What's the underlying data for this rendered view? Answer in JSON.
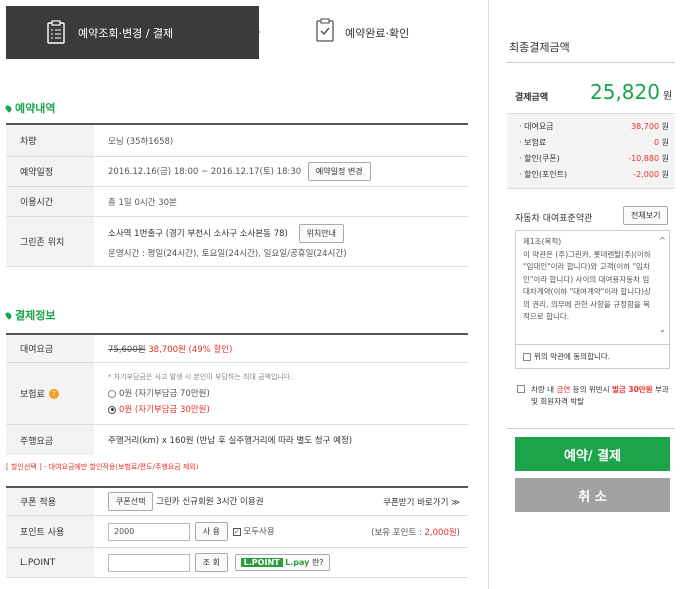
{
  "steps": {
    "step1": "예약조회·변경 / 결제",
    "step2": "예약완료·확인"
  },
  "reservation": {
    "title": "예약내역",
    "rows": {
      "car": {
        "label": "차량",
        "value": "모닝 (35하1658)"
      },
      "schedule": {
        "label": "예약일정",
        "value": "2016.12.16(금) 18:00 ~ 2016.12.17(토) 18:30",
        "button": "예약일정 변경"
      },
      "usage": {
        "label": "이용시간",
        "value": "총 1일 0시간 30분"
      },
      "greenzone": {
        "label": "그린존 위치",
        "address": "소사역 1번출구 (경기 부천시 소사구 소사본동 78)",
        "button": "위치안내",
        "hours": "운영시간 : 평일(24시간), 토요일(24시간), 일요일/공휴일(24시간)"
      }
    }
  },
  "payment": {
    "title": "결제정보",
    "fee": {
      "label": "대여요금",
      "original": "75,600원",
      "discounted": "38,700원 (49% 할인)"
    },
    "insurance": {
      "label": "보험료",
      "note": "* 자기부담금은 사고 발생 시 본인이 부담하는 최대 금액입니다.",
      "opt1": "0원 (자기부담금 70만원)",
      "opt2": "0원 (자기부담금 30만원)",
      "selected": "opt2"
    },
    "mileage": {
      "label": "주행요금",
      "value": "주행거리(km) x 160원 (반납 후 실주행거리에 따라 별도 청구 예정)"
    },
    "discount_note": "[ 할인선택 ] - 대여요금에만 할인적용(보험료/편도/주행요금 제외)",
    "coupon": {
      "label": "쿠폰 적용",
      "button": "쿠폰선택",
      "desc": "그린카 신규회원 3시간 이용권",
      "link": "쿠폰받기 바로가기 ≫"
    },
    "points": {
      "label": "포인트 사용",
      "value": "2000",
      "button": "사 용",
      "checkbox": "모두사용",
      "balance_label": "(보유 포인트 : ",
      "balance": "2,000원",
      "balance_end": ")"
    },
    "lpoint": {
      "label": "L.POINT",
      "button": "조 회",
      "badge_l": "L.POINT",
      "badge_p": "L.pay",
      "badge_q": "란?"
    }
  },
  "summary": {
    "title": "최종결제금액",
    "total_label": "결제금액",
    "total": "25,820",
    "unit": "원",
    "items": [
      {
        "label": "대여요금",
        "value": "38,700",
        "unit": "원",
        "red": true
      },
      {
        "label": "보험료",
        "value": "0",
        "unit": "원",
        "red": true
      },
      {
        "label": "할인(쿠폰)",
        "value": "-10,880",
        "unit": "원",
        "red": true
      },
      {
        "label": "할인(포인트)",
        "value": "-2,000",
        "unit": "원",
        "red": true
      }
    ],
    "terms_title": "자동차 대여표준약관",
    "terms_button": "전체보기",
    "terms_text": "제1조(목적)\n이 약관은 (주)그린카, 롯데렌탈(주)(이하 \"임대인\"이라 합니다)와 고객(이하 \"임차인\"이라 합니다) 사이의 대여용자동차 임대차계약(이하 \"대여계약\"이라 합니다)상의 권리, 의무에 관한 사항을 규정함을 목적으로 합니다.",
    "terms_agree": "위의 약관에 동의합니다.",
    "notice_pre": "차량 내 ",
    "notice_red1": "금연",
    "notice_mid": " 등의 위반시 ",
    "notice_red2": "벌금 30만원",
    "notice_post": " 부과 및 회원자격 박탈",
    "pay_button": "예약/ 결제",
    "cancel_button": "취 소"
  }
}
